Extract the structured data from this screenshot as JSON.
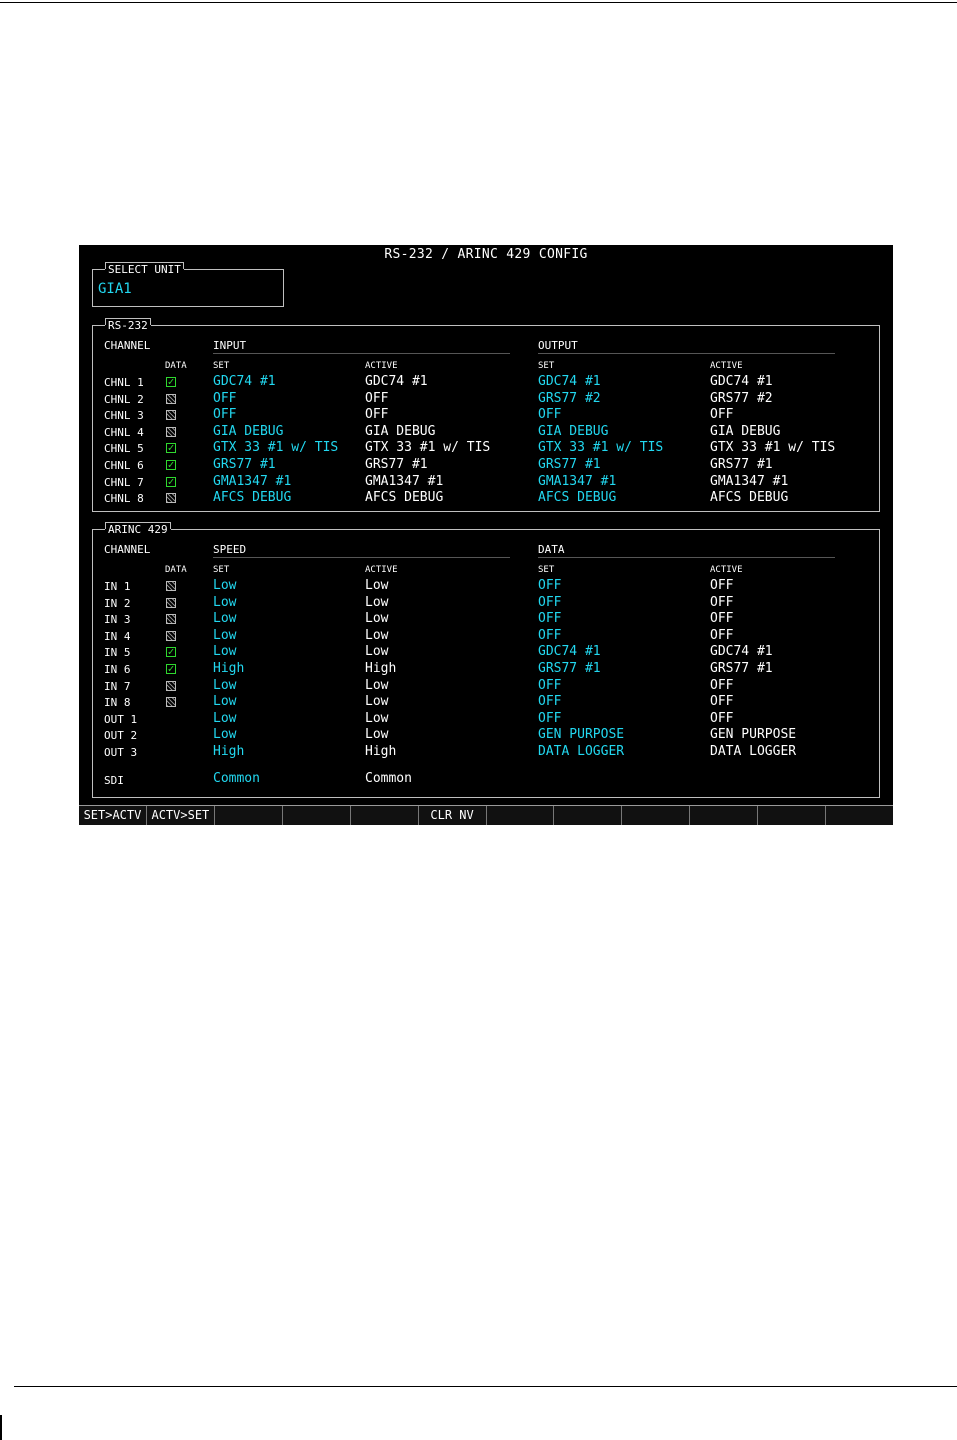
{
  "screen": {
    "title": "RS-232 / ARINC 429 CONFIG",
    "select_unit": {
      "legend": "SELECT UNIT",
      "value": "GIA1"
    },
    "rs232": {
      "legend": "RS-232",
      "channel_header": "CHANNEL",
      "data_header": "DATA",
      "input_header": "INPUT",
      "output_header": "OUTPUT",
      "set_header": "SET",
      "active_header": "ACTIVE",
      "rows": [
        {
          "channel": "CHNL 1",
          "data": true,
          "in_set": "GDC74 #1",
          "in_active": "GDC74 #1",
          "out_set": "GDC74 #1",
          "out_active": "GDC74 #1"
        },
        {
          "channel": "CHNL 2",
          "data": false,
          "in_set": "OFF",
          "in_active": "OFF",
          "out_set": "GRS77 #2",
          "out_active": "GRS77 #2"
        },
        {
          "channel": "CHNL 3",
          "data": false,
          "in_set": "OFF",
          "in_active": "OFF",
          "out_set": "OFF",
          "out_active": "OFF"
        },
        {
          "channel": "CHNL 4",
          "data": false,
          "in_set": "GIA DEBUG",
          "in_active": "GIA DEBUG",
          "out_set": "GIA DEBUG",
          "out_active": "GIA DEBUG"
        },
        {
          "channel": "CHNL 5",
          "data": true,
          "in_set": "GTX 33 #1 w/ TIS",
          "in_active": "GTX 33 #1 w/ TIS",
          "out_set": "GTX 33 #1 w/ TIS",
          "out_active": "GTX 33 #1 w/ TIS"
        },
        {
          "channel": "CHNL 6",
          "data": true,
          "in_set": "GRS77 #1",
          "in_active": "GRS77 #1",
          "out_set": "GRS77 #1",
          "out_active": "GRS77 #1"
        },
        {
          "channel": "CHNL 7",
          "data": true,
          "in_set": "GMA1347 #1",
          "in_active": "GMA1347 #1",
          "out_set": "GMA1347 #1",
          "out_active": "GMA1347 #1"
        },
        {
          "channel": "CHNL 8",
          "data": false,
          "in_set": "AFCS DEBUG",
          "in_active": "AFCS DEBUG",
          "out_set": "AFCS DEBUG",
          "out_active": "AFCS DEBUG"
        }
      ]
    },
    "arinc429": {
      "legend": "ARINC 429",
      "channel_header": "CHANNEL",
      "data_col_header": "DATA",
      "speed_header": "SPEED",
      "data_header": "DATA",
      "set_header": "SET",
      "active_header": "ACTIVE",
      "rows": [
        {
          "channel": "IN 1",
          "data": false,
          "speed_set": "Low",
          "speed_active": "Low",
          "data_set": "OFF",
          "data_active": "OFF"
        },
        {
          "channel": "IN 2",
          "data": false,
          "speed_set": "Low",
          "speed_active": "Low",
          "data_set": "OFF",
          "data_active": "OFF"
        },
        {
          "channel": "IN 3",
          "data": false,
          "speed_set": "Low",
          "speed_active": "Low",
          "data_set": "OFF",
          "data_active": "OFF"
        },
        {
          "channel": "IN 4",
          "data": false,
          "speed_set": "Low",
          "speed_active": "Low",
          "data_set": "OFF",
          "data_active": "OFF"
        },
        {
          "channel": "IN 5",
          "data": true,
          "speed_set": "Low",
          "speed_active": "Low",
          "data_set": "GDC74 #1",
          "data_active": "GDC74 #1"
        },
        {
          "channel": "IN 6",
          "data": true,
          "speed_set": "High",
          "speed_active": "High",
          "data_set": "GRS77 #1",
          "data_active": "GRS77 #1"
        },
        {
          "channel": "IN 7",
          "data": false,
          "speed_set": "Low",
          "speed_active": "Low",
          "data_set": "OFF",
          "data_active": "OFF"
        },
        {
          "channel": "IN 8",
          "data": false,
          "speed_set": "Low",
          "speed_active": "Low",
          "data_set": "OFF",
          "data_active": "OFF"
        },
        {
          "channel": "OUT 1",
          "data": null,
          "speed_set": "Low",
          "speed_active": "Low",
          "data_set": "OFF",
          "data_active": "OFF"
        },
        {
          "channel": "OUT 2",
          "data": null,
          "speed_set": "Low",
          "speed_active": "Low",
          "data_set": "GEN PURPOSE",
          "data_active": "GEN PURPOSE"
        },
        {
          "channel": "OUT 3",
          "data": null,
          "speed_set": "High",
          "speed_active": "High",
          "data_set": "DATA LOGGER",
          "data_active": "DATA LOGGER"
        }
      ],
      "sdi": {
        "label": "SDI",
        "set": "Common",
        "active": "Common"
      }
    },
    "softkeys": [
      "SET>ACTV",
      "ACTV>SET",
      "",
      "",
      "",
      "CLR NV",
      "",
      "",
      "",
      "",
      "",
      ""
    ],
    "colors": {
      "set_value": "#22d8f0",
      "active_value": "#ffffff",
      "check_on": "#2fd82f",
      "background": "#000000"
    }
  }
}
